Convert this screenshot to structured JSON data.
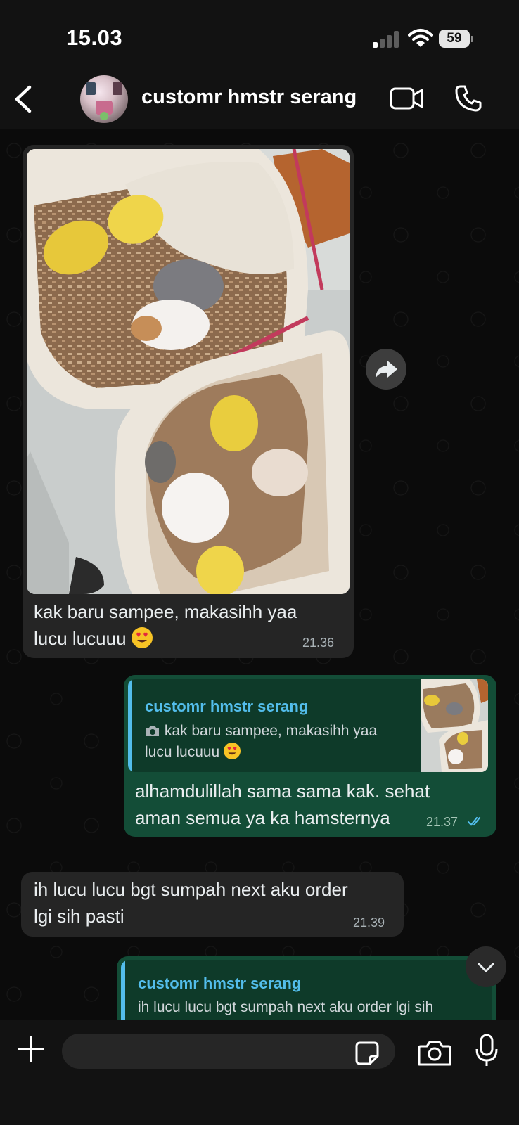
{
  "status_bar": {
    "time": "15.03",
    "battery": "59"
  },
  "header": {
    "contact_name": "customr hmstr serang",
    "back_icon": "chevron-left-icon",
    "video_icon": "video-camera-icon",
    "call_icon": "phone-icon"
  },
  "messages": [
    {
      "direction": "in",
      "type": "image",
      "text_line1": "kak baru sampee, makasihh yaa",
      "text_line2": "lucu lucuuu",
      "emoji": "heart-eyes",
      "time": "21.36"
    },
    {
      "direction": "out",
      "quoted_name": "customr hmstr serang",
      "quoted_line1": "kak baru sampee, makasihh yaa",
      "quoted_line2": "lucu lucuuu",
      "text_line1": "alhamdulillah sama sama kak. sehat",
      "text_line2": "aman semua ya ka hamsternya",
      "time": "21.37",
      "status": "read"
    },
    {
      "direction": "in",
      "text_line1": "ih lucu lucu bgt sumpah next aku order",
      "text_line2": "lgi sih pasti",
      "time": "21.39"
    },
    {
      "direction": "out",
      "quoted_name": "customr hmstr serang",
      "quoted_line1": "ih lucu lucu bgt sumpah next aku order lgi sih"
    }
  ],
  "composer": {
    "placeholder": ""
  },
  "colors": {
    "incoming": "#252525",
    "outgoing": "#134d37",
    "quote_accent": "#53bdeb",
    "read_ticks": "#53bdeb"
  }
}
